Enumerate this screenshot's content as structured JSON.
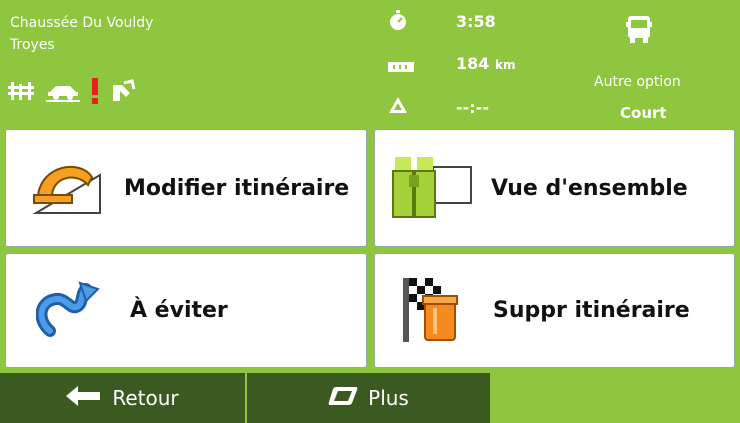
{
  "address": {
    "street": "Chaussée Du Vouldy",
    "city": "Troyes"
  },
  "route_icons": [
    "highway-icon",
    "car-ferry-icon",
    "warning-icon",
    "toll-icon"
  ],
  "stats": {
    "time": "3:58",
    "distance": "184",
    "distance_unit": "km",
    "eta": "--:--"
  },
  "vehicle": {
    "icon": "truck-icon",
    "option_label": "Autre option",
    "option_value": "Court"
  },
  "buttons": {
    "modify": "Modifier itinéraire",
    "overview": "Vue d'ensemble",
    "avoid": "À éviter",
    "delete": "Suppr itinéraire"
  },
  "footer": {
    "back": "Retour",
    "more": "Plus"
  },
  "colors": {
    "header_bg": "#8ec63f",
    "footer_btn": "#3a5a22"
  }
}
